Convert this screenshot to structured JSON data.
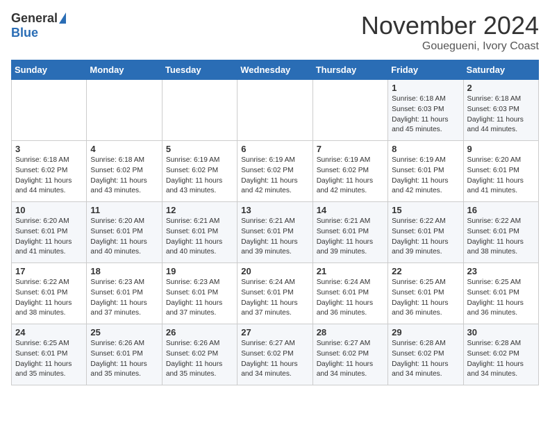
{
  "header": {
    "logo_general": "General",
    "logo_blue": "Blue",
    "month_title": "November 2024",
    "location": "Gouegueni, Ivory Coast"
  },
  "weekdays": [
    "Sunday",
    "Monday",
    "Tuesday",
    "Wednesday",
    "Thursday",
    "Friday",
    "Saturday"
  ],
  "weeks": [
    [
      {
        "day": "",
        "info": ""
      },
      {
        "day": "",
        "info": ""
      },
      {
        "day": "",
        "info": ""
      },
      {
        "day": "",
        "info": ""
      },
      {
        "day": "",
        "info": ""
      },
      {
        "day": "1",
        "info": "Sunrise: 6:18 AM\nSunset: 6:03 PM\nDaylight: 11 hours\nand 45 minutes."
      },
      {
        "day": "2",
        "info": "Sunrise: 6:18 AM\nSunset: 6:03 PM\nDaylight: 11 hours\nand 44 minutes."
      }
    ],
    [
      {
        "day": "3",
        "info": "Sunrise: 6:18 AM\nSunset: 6:02 PM\nDaylight: 11 hours\nand 44 minutes."
      },
      {
        "day": "4",
        "info": "Sunrise: 6:18 AM\nSunset: 6:02 PM\nDaylight: 11 hours\nand 43 minutes."
      },
      {
        "day": "5",
        "info": "Sunrise: 6:19 AM\nSunset: 6:02 PM\nDaylight: 11 hours\nand 43 minutes."
      },
      {
        "day": "6",
        "info": "Sunrise: 6:19 AM\nSunset: 6:02 PM\nDaylight: 11 hours\nand 42 minutes."
      },
      {
        "day": "7",
        "info": "Sunrise: 6:19 AM\nSunset: 6:02 PM\nDaylight: 11 hours\nand 42 minutes."
      },
      {
        "day": "8",
        "info": "Sunrise: 6:19 AM\nSunset: 6:01 PM\nDaylight: 11 hours\nand 42 minutes."
      },
      {
        "day": "9",
        "info": "Sunrise: 6:20 AM\nSunset: 6:01 PM\nDaylight: 11 hours\nand 41 minutes."
      }
    ],
    [
      {
        "day": "10",
        "info": "Sunrise: 6:20 AM\nSunset: 6:01 PM\nDaylight: 11 hours\nand 41 minutes."
      },
      {
        "day": "11",
        "info": "Sunrise: 6:20 AM\nSunset: 6:01 PM\nDaylight: 11 hours\nand 40 minutes."
      },
      {
        "day": "12",
        "info": "Sunrise: 6:21 AM\nSunset: 6:01 PM\nDaylight: 11 hours\nand 40 minutes."
      },
      {
        "day": "13",
        "info": "Sunrise: 6:21 AM\nSunset: 6:01 PM\nDaylight: 11 hours\nand 39 minutes."
      },
      {
        "day": "14",
        "info": "Sunrise: 6:21 AM\nSunset: 6:01 PM\nDaylight: 11 hours\nand 39 minutes."
      },
      {
        "day": "15",
        "info": "Sunrise: 6:22 AM\nSunset: 6:01 PM\nDaylight: 11 hours\nand 39 minutes."
      },
      {
        "day": "16",
        "info": "Sunrise: 6:22 AM\nSunset: 6:01 PM\nDaylight: 11 hours\nand 38 minutes."
      }
    ],
    [
      {
        "day": "17",
        "info": "Sunrise: 6:22 AM\nSunset: 6:01 PM\nDaylight: 11 hours\nand 38 minutes."
      },
      {
        "day": "18",
        "info": "Sunrise: 6:23 AM\nSunset: 6:01 PM\nDaylight: 11 hours\nand 37 minutes."
      },
      {
        "day": "19",
        "info": "Sunrise: 6:23 AM\nSunset: 6:01 PM\nDaylight: 11 hours\nand 37 minutes."
      },
      {
        "day": "20",
        "info": "Sunrise: 6:24 AM\nSunset: 6:01 PM\nDaylight: 11 hours\nand 37 minutes."
      },
      {
        "day": "21",
        "info": "Sunrise: 6:24 AM\nSunset: 6:01 PM\nDaylight: 11 hours\nand 36 minutes."
      },
      {
        "day": "22",
        "info": "Sunrise: 6:25 AM\nSunset: 6:01 PM\nDaylight: 11 hours\nand 36 minutes."
      },
      {
        "day": "23",
        "info": "Sunrise: 6:25 AM\nSunset: 6:01 PM\nDaylight: 11 hours\nand 36 minutes."
      }
    ],
    [
      {
        "day": "24",
        "info": "Sunrise: 6:25 AM\nSunset: 6:01 PM\nDaylight: 11 hours\nand 35 minutes."
      },
      {
        "day": "25",
        "info": "Sunrise: 6:26 AM\nSunset: 6:01 PM\nDaylight: 11 hours\nand 35 minutes."
      },
      {
        "day": "26",
        "info": "Sunrise: 6:26 AM\nSunset: 6:02 PM\nDaylight: 11 hours\nand 35 minutes."
      },
      {
        "day": "27",
        "info": "Sunrise: 6:27 AM\nSunset: 6:02 PM\nDaylight: 11 hours\nand 34 minutes."
      },
      {
        "day": "28",
        "info": "Sunrise: 6:27 AM\nSunset: 6:02 PM\nDaylight: 11 hours\nand 34 minutes."
      },
      {
        "day": "29",
        "info": "Sunrise: 6:28 AM\nSunset: 6:02 PM\nDaylight: 11 hours\nand 34 minutes."
      },
      {
        "day": "30",
        "info": "Sunrise: 6:28 AM\nSunset: 6:02 PM\nDaylight: 11 hours\nand 34 minutes."
      }
    ]
  ]
}
